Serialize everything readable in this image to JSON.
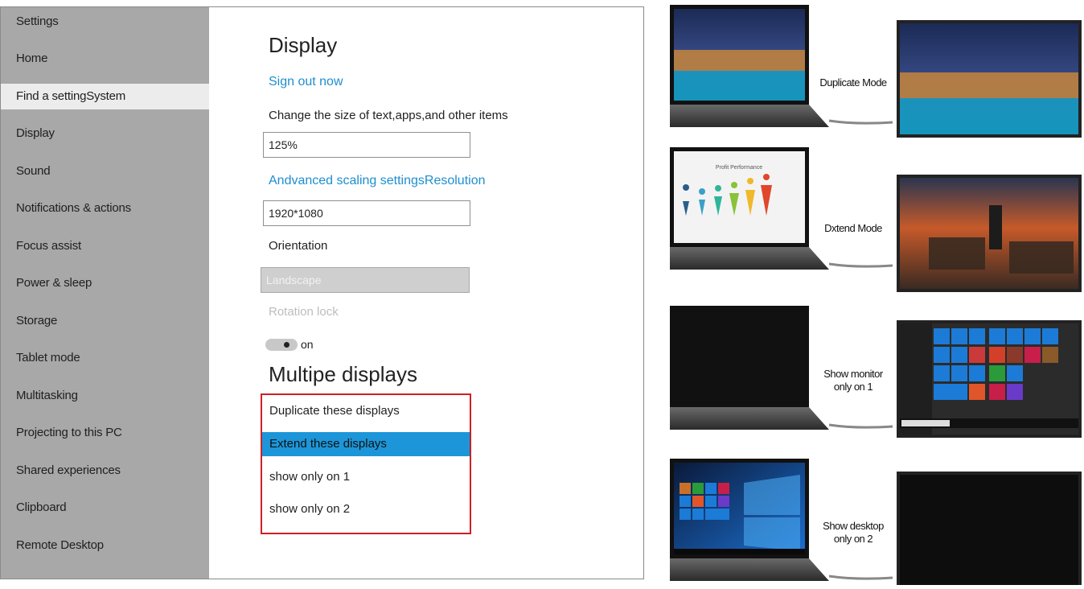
{
  "sidebar": {
    "items": [
      {
        "label": "Settings"
      },
      {
        "label": "Home"
      },
      {
        "label": "Find a settingSystem"
      },
      {
        "label": "Display"
      },
      {
        "label": "Sound"
      },
      {
        "label": "Notifications & actions"
      },
      {
        "label": "Focus assist"
      },
      {
        "label": "Power & sleep"
      },
      {
        "label": "Storage"
      },
      {
        "label": "Tablet mode"
      },
      {
        "label": "Multitasking"
      },
      {
        "label": "Projecting to this PC"
      },
      {
        "label": "Shared experiences"
      },
      {
        "label": "Clipboard"
      },
      {
        "label": "Remote Desktop"
      }
    ]
  },
  "main": {
    "title": "Display",
    "sign_out": "Sign out now",
    "scale_label": "Change the size of text,apps,and other items",
    "scale_value": "125%",
    "advanced_link": "Andvanced scaling settingsResolution",
    "resolution_value": "1920*1080",
    "orientation_label": "Orientation",
    "orientation_value": "Landscape",
    "rotation_lock_label": "Rotation lock",
    "rotation_lock_state": "on",
    "multi_title": "Multipe displays",
    "multi_options": [
      {
        "label": "Duplicate these displays",
        "selected": false
      },
      {
        "label": "Extend these displays",
        "selected": true
      },
      {
        "label": "show only on 1",
        "selected": false
      },
      {
        "label": "show only on 2",
        "selected": false
      }
    ]
  },
  "modes": {
    "duplicate": "Duplicate Mode",
    "extend": "Dxtend Mode",
    "monitor_only_1": "Show monitor",
    "monitor_only_2": "only on 1",
    "desktop_only_1": "Show desktop",
    "desktop_only_2": "only on 2",
    "chart_title": "Profit Performance"
  },
  "colors": {
    "accent": "#1c96d8",
    "link": "#1e8ed0",
    "sidebar": "#a8a8a8",
    "highlight_border": "#d01f25"
  }
}
